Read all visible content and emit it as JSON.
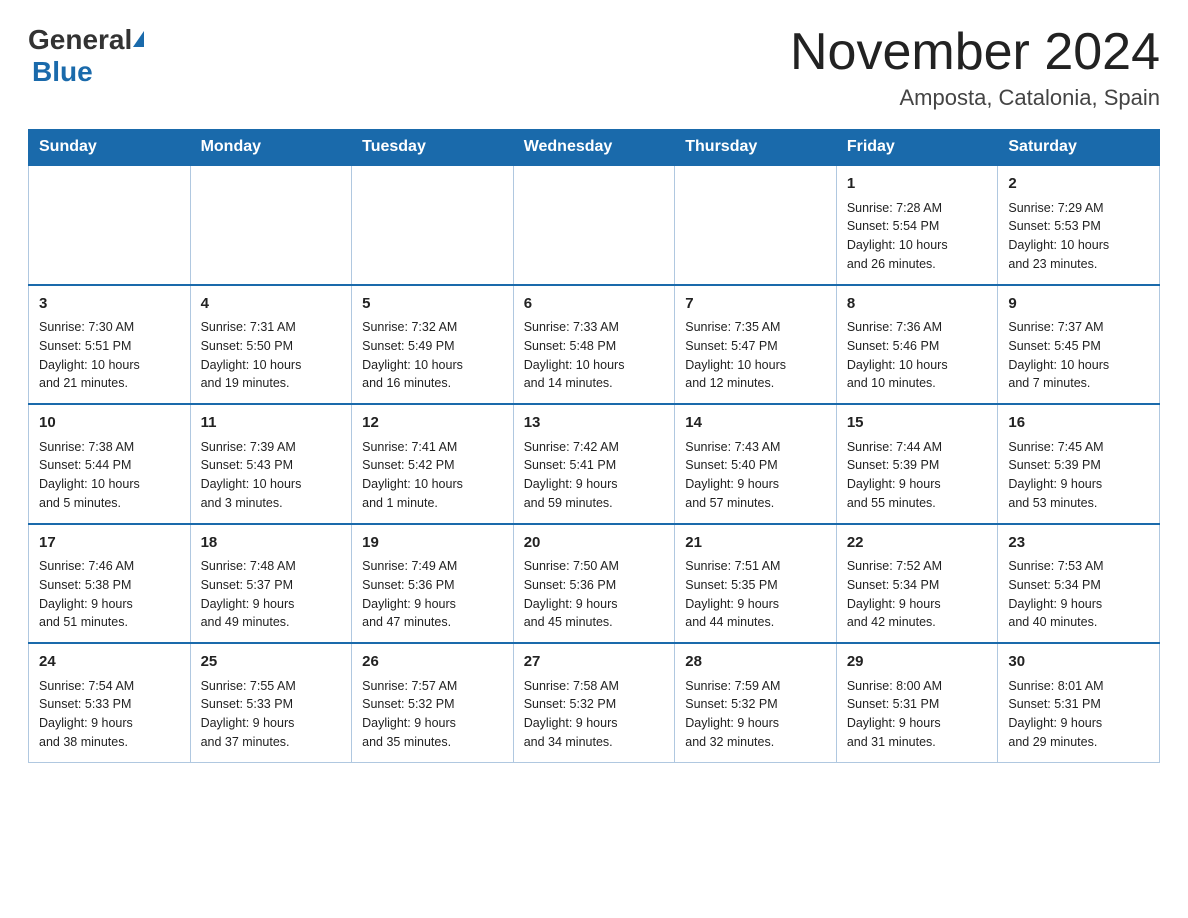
{
  "header": {
    "logo_general": "General",
    "logo_blue": "Blue",
    "title": "November 2024",
    "subtitle": "Amposta, Catalonia, Spain"
  },
  "days_of_week": [
    "Sunday",
    "Monday",
    "Tuesday",
    "Wednesday",
    "Thursday",
    "Friday",
    "Saturday"
  ],
  "weeks": [
    [
      {
        "day": "",
        "info": ""
      },
      {
        "day": "",
        "info": ""
      },
      {
        "day": "",
        "info": ""
      },
      {
        "day": "",
        "info": ""
      },
      {
        "day": "",
        "info": ""
      },
      {
        "day": "1",
        "info": "Sunrise: 7:28 AM\nSunset: 5:54 PM\nDaylight: 10 hours\nand 26 minutes."
      },
      {
        "day": "2",
        "info": "Sunrise: 7:29 AM\nSunset: 5:53 PM\nDaylight: 10 hours\nand 23 minutes."
      }
    ],
    [
      {
        "day": "3",
        "info": "Sunrise: 7:30 AM\nSunset: 5:51 PM\nDaylight: 10 hours\nand 21 minutes."
      },
      {
        "day": "4",
        "info": "Sunrise: 7:31 AM\nSunset: 5:50 PM\nDaylight: 10 hours\nand 19 minutes."
      },
      {
        "day": "5",
        "info": "Sunrise: 7:32 AM\nSunset: 5:49 PM\nDaylight: 10 hours\nand 16 minutes."
      },
      {
        "day": "6",
        "info": "Sunrise: 7:33 AM\nSunset: 5:48 PM\nDaylight: 10 hours\nand 14 minutes."
      },
      {
        "day": "7",
        "info": "Sunrise: 7:35 AM\nSunset: 5:47 PM\nDaylight: 10 hours\nand 12 minutes."
      },
      {
        "day": "8",
        "info": "Sunrise: 7:36 AM\nSunset: 5:46 PM\nDaylight: 10 hours\nand 10 minutes."
      },
      {
        "day": "9",
        "info": "Sunrise: 7:37 AM\nSunset: 5:45 PM\nDaylight: 10 hours\nand 7 minutes."
      }
    ],
    [
      {
        "day": "10",
        "info": "Sunrise: 7:38 AM\nSunset: 5:44 PM\nDaylight: 10 hours\nand 5 minutes."
      },
      {
        "day": "11",
        "info": "Sunrise: 7:39 AM\nSunset: 5:43 PM\nDaylight: 10 hours\nand 3 minutes."
      },
      {
        "day": "12",
        "info": "Sunrise: 7:41 AM\nSunset: 5:42 PM\nDaylight: 10 hours\nand 1 minute."
      },
      {
        "day": "13",
        "info": "Sunrise: 7:42 AM\nSunset: 5:41 PM\nDaylight: 9 hours\nand 59 minutes."
      },
      {
        "day": "14",
        "info": "Sunrise: 7:43 AM\nSunset: 5:40 PM\nDaylight: 9 hours\nand 57 minutes."
      },
      {
        "day": "15",
        "info": "Sunrise: 7:44 AM\nSunset: 5:39 PM\nDaylight: 9 hours\nand 55 minutes."
      },
      {
        "day": "16",
        "info": "Sunrise: 7:45 AM\nSunset: 5:39 PM\nDaylight: 9 hours\nand 53 minutes."
      }
    ],
    [
      {
        "day": "17",
        "info": "Sunrise: 7:46 AM\nSunset: 5:38 PM\nDaylight: 9 hours\nand 51 minutes."
      },
      {
        "day": "18",
        "info": "Sunrise: 7:48 AM\nSunset: 5:37 PM\nDaylight: 9 hours\nand 49 minutes."
      },
      {
        "day": "19",
        "info": "Sunrise: 7:49 AM\nSunset: 5:36 PM\nDaylight: 9 hours\nand 47 minutes."
      },
      {
        "day": "20",
        "info": "Sunrise: 7:50 AM\nSunset: 5:36 PM\nDaylight: 9 hours\nand 45 minutes."
      },
      {
        "day": "21",
        "info": "Sunrise: 7:51 AM\nSunset: 5:35 PM\nDaylight: 9 hours\nand 44 minutes."
      },
      {
        "day": "22",
        "info": "Sunrise: 7:52 AM\nSunset: 5:34 PM\nDaylight: 9 hours\nand 42 minutes."
      },
      {
        "day": "23",
        "info": "Sunrise: 7:53 AM\nSunset: 5:34 PM\nDaylight: 9 hours\nand 40 minutes."
      }
    ],
    [
      {
        "day": "24",
        "info": "Sunrise: 7:54 AM\nSunset: 5:33 PM\nDaylight: 9 hours\nand 38 minutes."
      },
      {
        "day": "25",
        "info": "Sunrise: 7:55 AM\nSunset: 5:33 PM\nDaylight: 9 hours\nand 37 minutes."
      },
      {
        "day": "26",
        "info": "Sunrise: 7:57 AM\nSunset: 5:32 PM\nDaylight: 9 hours\nand 35 minutes."
      },
      {
        "day": "27",
        "info": "Sunrise: 7:58 AM\nSunset: 5:32 PM\nDaylight: 9 hours\nand 34 minutes."
      },
      {
        "day": "28",
        "info": "Sunrise: 7:59 AM\nSunset: 5:32 PM\nDaylight: 9 hours\nand 32 minutes."
      },
      {
        "day": "29",
        "info": "Sunrise: 8:00 AM\nSunset: 5:31 PM\nDaylight: 9 hours\nand 31 minutes."
      },
      {
        "day": "30",
        "info": "Sunrise: 8:01 AM\nSunset: 5:31 PM\nDaylight: 9 hours\nand 29 minutes."
      }
    ]
  ]
}
